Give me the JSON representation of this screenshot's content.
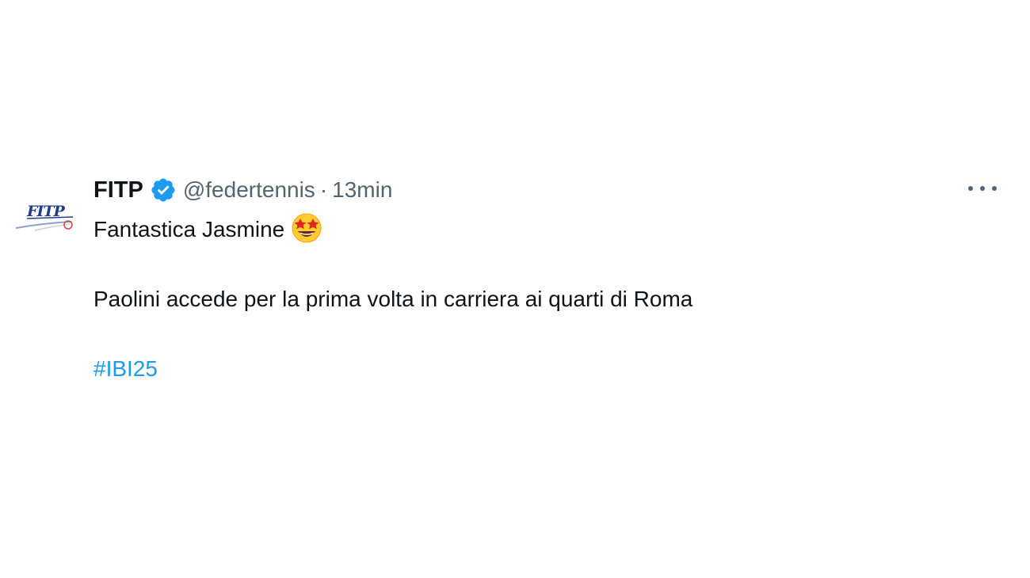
{
  "tweet": {
    "author": {
      "name": "FITP",
      "handle": "@federtennis",
      "verified": true,
      "avatar_icon": "fitp-logo-icon"
    },
    "separator": "·",
    "time": "13min",
    "more_icon": "more-options-icon",
    "text": {
      "line1": "Fantastica Jasmine",
      "line1_emoji": "star-struck-emoji-icon",
      "line2": "Paolini accede per la prima volta in carriera ai quarti di Roma",
      "hashtag": "#IBI25"
    },
    "colors": {
      "text": "#0f1419",
      "secondary": "#536471",
      "link": "#1d9bf0",
      "verified": "#1d9bf0"
    }
  }
}
